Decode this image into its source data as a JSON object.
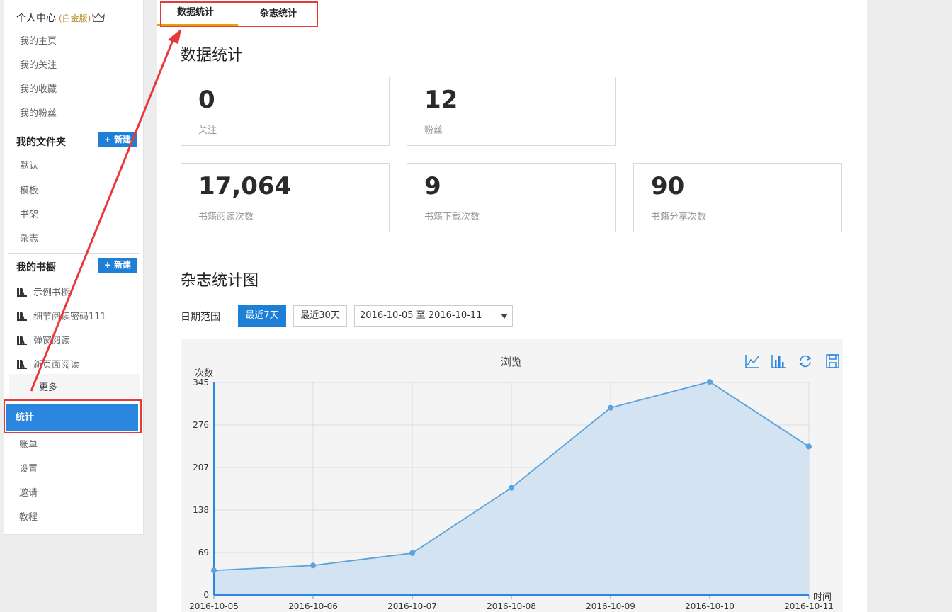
{
  "sidebar": {
    "personal": {
      "title": "个人中心",
      "badge": "(白金版)"
    },
    "personal_items": [
      "我的主页",
      "我的关注",
      "我的收藏",
      "我的粉丝"
    ],
    "folders": {
      "title": "我的文件夹",
      "new_label": "+ 新建",
      "items": [
        "默认",
        "模板",
        "书架",
        "杂志"
      ]
    },
    "shelves": {
      "title": "我的书橱",
      "new_label": "+ 新建",
      "items": [
        "示例书橱",
        "细节阅读密码111",
        "弹窗阅读",
        "新页面阅读"
      ],
      "more": "更多"
    },
    "active_item": "统计",
    "bottom_items": [
      "账单",
      "设置",
      "邀请",
      "教程"
    ]
  },
  "tabs": [
    "数据统计",
    "杂志统计"
  ],
  "main": {
    "title": "数据统计",
    "stats": [
      {
        "value": "0",
        "label": "关注"
      },
      {
        "value": "12",
        "label": "粉丝"
      },
      {
        "value": "17,064",
        "label": "书籍阅读次数"
      },
      {
        "value": "9",
        "label": "书籍下载次数"
      },
      {
        "value": "90",
        "label": "书籍分享次数"
      }
    ],
    "chart_title_section": "杂志统计图",
    "filter": {
      "label": "日期范围",
      "btn_7": "最近7天",
      "btn_30": "最近30天",
      "range": "2016-10-05 至 2016-10-11"
    }
  },
  "chart_data": {
    "type": "area",
    "title": "浏览",
    "ylabel": "次数",
    "xlabel": "时间",
    "categories": [
      "2016-10-05",
      "2016-10-06",
      "2016-10-07",
      "2016-10-08",
      "2016-10-09",
      "2016-10-10",
      "2016-10-11"
    ],
    "y_ticks": [
      0,
      69,
      138,
      207,
      276,
      345
    ],
    "ylim": [
      0,
      345
    ],
    "series": [
      {
        "values": [
          40,
          48,
          68,
          174,
          304,
          346,
          241
        ]
      }
    ],
    "grid": true,
    "toolbox": [
      "line-chart-icon",
      "bar-chart-icon",
      "refresh-icon",
      "save-icon"
    ],
    "colors": {
      "line": "#5ba3dc",
      "fill": "#d3e3f1"
    }
  },
  "colors": {
    "primary": "#1e7fd6",
    "active": "#2b86e0",
    "highlight": "#e8393a",
    "gold": "#b8922f"
  }
}
